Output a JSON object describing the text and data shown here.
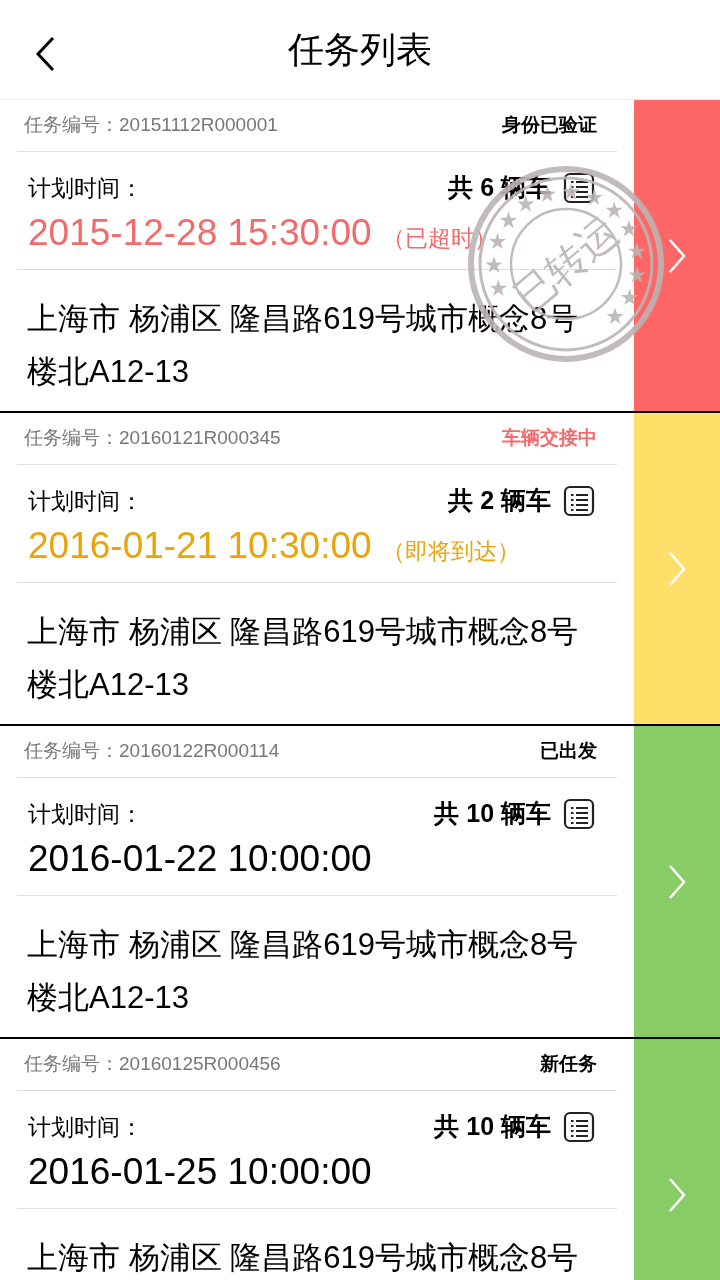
{
  "header": {
    "title": "任务列表"
  },
  "tasks": [
    {
      "id_label": "任务编号：",
      "id": "20151112R000001",
      "status": {
        "text": "身份已验证",
        "color": "#000000"
      },
      "time_label": "计划时间：",
      "count": "共 6 辆车",
      "time": {
        "datetime": "2015-12-28 15:30:00",
        "note": "（已超时）",
        "color": "#f26a6a"
      },
      "address": "上海市 杨浦区 隆昌路619号城市概念8号楼北A12-13",
      "color": "#ff6666",
      "stamp": "已转运"
    },
    {
      "id_label": "任务编号：",
      "id": "20160121R000345",
      "status": {
        "text": "车辆交接中",
        "color": "#f26a6a"
      },
      "time_label": "计划时间：",
      "count": "共 2 辆车",
      "time": {
        "datetime": "2016-01-21 10:30:00",
        "note": "（即将到达）",
        "color": "#eaa30b"
      },
      "address": "上海市 杨浦区 隆昌路619号城市概念8号楼北A12-13",
      "color": "#ffdf6a"
    },
    {
      "id_label": "任务编号：",
      "id": "20160122R000114",
      "status": {
        "text": "已出发",
        "color": "#000000"
      },
      "time_label": "计划时间：",
      "count": "共 10 辆车",
      "time": {
        "datetime": "2016-01-22 10:00:00",
        "color": "#000000"
      },
      "address": "上海市 杨浦区 隆昌路619号城市概念8号楼北A12-13",
      "color": "#88cc66"
    },
    {
      "id_label": "任务编号：",
      "id": "20160125R000456",
      "status": {
        "text": "新任务",
        "color": "#000000"
      },
      "time_label": "计划时间：",
      "count": "共 10 辆车",
      "time": {
        "datetime": "2016-01-25 10:00:00",
        "color": "#000000"
      },
      "address": "上海市 杨浦区 隆昌路619号城市概念8号",
      "color": "#88cc66"
    }
  ]
}
